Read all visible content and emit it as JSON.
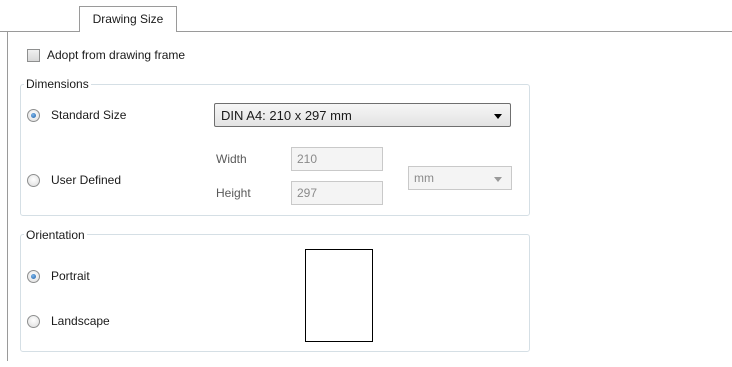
{
  "tab": {
    "label": "Drawing Size"
  },
  "adopt": {
    "label": "Adopt from drawing frame",
    "checked": false
  },
  "dimensions": {
    "legend": "Dimensions",
    "standard_label": "Standard Size",
    "standard_selected": true,
    "standard_value": "DIN A4: 210 x  297 mm",
    "user_label": "User Defined",
    "user_selected": false,
    "width_label": "Width",
    "width_value": "210",
    "height_label": "Height",
    "height_value": "297",
    "unit_value": "mm"
  },
  "orientation": {
    "legend": "Orientation",
    "portrait_label": "Portrait",
    "portrait_selected": true,
    "landscape_label": "Landscape",
    "landscape_selected": false
  },
  "icons": {
    "dropdown": "chevron-down-icon"
  },
  "colors": {
    "border": "#9a9a9a",
    "group_border": "#d5dfe5",
    "radio_dot": "#1b5fa8"
  }
}
